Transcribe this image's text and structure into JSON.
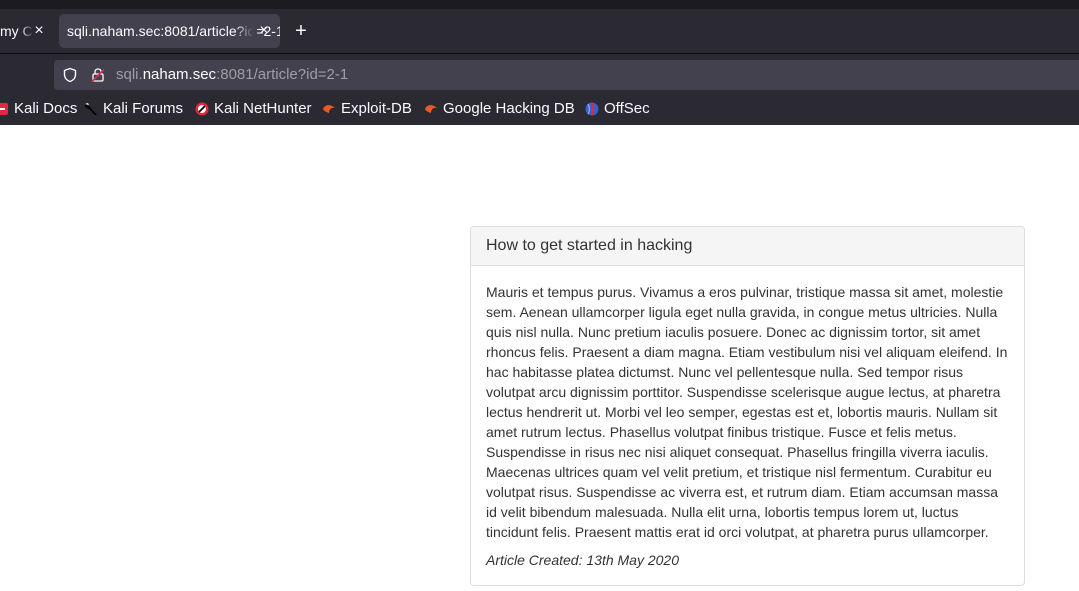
{
  "browser": {
    "tabs": [
      {
        "label": "my C",
        "active": false
      },
      {
        "label": "sqli.naham.sec:8081/article?id=2-1",
        "active": true
      }
    ],
    "url": {
      "prefix": "sqli.",
      "host": "naham.sec",
      "suffix": ":8081/article?id=2-1"
    },
    "bookmarks": [
      {
        "label": "Kali Docs",
        "icon": "kali-docs-icon"
      },
      {
        "label": "Kali Forums",
        "icon": "kali-dragon-icon"
      },
      {
        "label": "Kali NetHunter",
        "icon": "nethunter-icon"
      },
      {
        "label": "Exploit-DB",
        "icon": "exploit-db-icon"
      },
      {
        "label": "Google Hacking DB",
        "icon": "ghdb-icon"
      },
      {
        "label": "OffSec",
        "icon": "offsec-icon"
      }
    ]
  },
  "article": {
    "title": "How to get started in hacking",
    "body": "Mauris et tempus purus. Vivamus a eros pulvinar, tristique massa sit amet, molestie sem. Aenean ullamcorper ligula eget nulla gravida, in congue metus ultricies. Nulla quis nisl nulla. Nunc pretium iaculis posuere. Donec ac dignissim tortor, sit amet rhoncus felis. Praesent a diam magna. Etiam vestibulum nisi vel aliquam eleifend. In hac habitasse platea dictumst. Nunc vel pellentesque nulla. Sed tempor risus volutpat arcu dignissim porttitor. Suspendisse scelerisque augue lectus, at pharetra lectus hendrerit ut. Morbi vel leo semper, egestas est et, lobortis mauris. Nullam sit amet rutrum lectus. Phasellus volutpat finibus tristique. Fusce et felis metus. Suspendisse in risus nec nisi aliquet consequat. Phasellus fringilla viverra iaculis. Maecenas ultrices quam vel velit pretium, et tristique nisl fermentum. Curabitur eu volutpat risus. Suspendisse ac viverra est, et rutrum diam. Etiam accumsan massa id velit bibendum malesuada. Nulla elit urna, lobortis tempus lorem ut, luctus tincidunt felis. Praesent mattis erat id orci volutpat, at pharetra purus ullamcorper.",
    "created": "Article Created: 13th May 2020"
  },
  "colors": {
    "chrome": "#2b2a33",
    "active_tab": "#42414d",
    "card_border": "#dddddd",
    "card_header": "#f5f5f5"
  }
}
